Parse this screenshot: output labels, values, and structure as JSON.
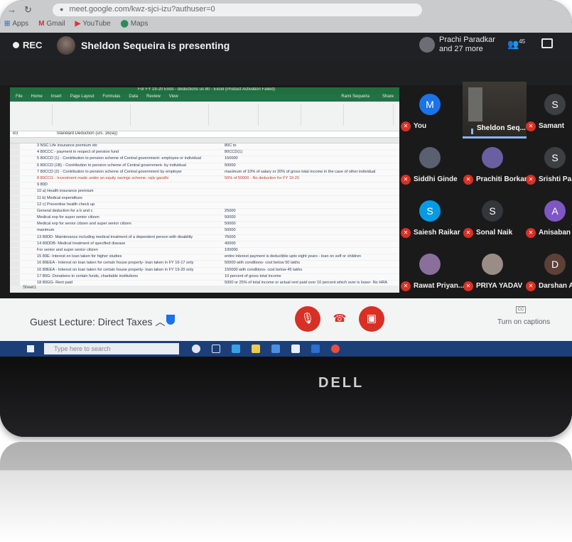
{
  "browser": {
    "url": "meet.google.com/kwz-sjci-izu?authuser=0",
    "bookmarks": [
      "Apps",
      "Gmail",
      "YouTube",
      "Maps"
    ]
  },
  "meet": {
    "rec_label": "REC",
    "presenting_text": "Sheldon Sequeira is presenting",
    "attendee_line1": "Prachi Paradkar",
    "attendee_line2": "and 27 more",
    "people_count": "45",
    "meeting_title": "Guest Lecture: Direct Taxes",
    "captions_label": "Turn on captions",
    "cc_label": "CC"
  },
  "excel": {
    "window_title": "For FY 19-20 Ends - deductions us 80 - Excel (Product Activation Failed)",
    "tabs": [
      "File",
      "Home",
      "Insert",
      "Page Layout",
      "Formulas",
      "Data",
      "Review",
      "View"
    ],
    "user": "Rami Sequeira",
    "share": "Share",
    "name_box": "B3",
    "formula": "Standard Deduction (u/s. 16(ia))",
    "sheet_tab": "Sheet1",
    "rows": [
      {
        "a": "3 NSC Life insurance premium etc",
        "c": "80C to"
      },
      {
        "a": "4 80CCC - payment in respect of pension fund",
        "c": "80CCD(1)"
      },
      {
        "a": "5 80CCD (1) - Contribution to pension scheme of Central government- employee or individual",
        "c": "150000"
      },
      {
        "a": "6 80CCD (1B) - Contribution to pension scheme of Central government- by individual",
        "c": "50000"
      },
      {
        "a": "7 80CCD (2) - Contribution to pension scheme of Central government by employer",
        "c": "maximum of 10% of salary or 20% of gross total income in the case of other individual"
      },
      {
        "a": "8 80CCG - Investment made under an equity savings scheme- rajiv gandhi",
        "c": "50% of 50000 - No deduction for FY 19-20",
        "red": true
      },
      {
        "a": "9 80D",
        "c": ""
      },
      {
        "a": "10 a) Health insurance premium",
        "c": ""
      },
      {
        "a": "11 b) Medical expenditure",
        "c": ""
      },
      {
        "a": "12 c) Preventive health check up",
        "c": ""
      },
      {
        "a": "General deduction for a b and c",
        "c": "25000"
      },
      {
        "a": "Medical exp for super senior citizen",
        "c": "50000"
      },
      {
        "a": "Medical exp for senior citizen and super senior citizen",
        "c": "50000"
      },
      {
        "a": "maximum",
        "c": "50000"
      },
      {
        "a": "13 80DD- Maintenance including medical treatment of a dependent person with disability",
        "c": "75000"
      },
      {
        "a": "14 80DDB- Medical treatment of specified disease",
        "c": "40000"
      },
      {
        "a": "For senior and super senior citizen",
        "c": "100000"
      },
      {
        "a": "15 80E- Interest on loan taken for higher studies",
        "c": "entire interest payment is deductible upto eight years - loan on self or children"
      },
      {
        "a": "16 80EEA - Interest on loan taken for certain house property- loan taken in FY 16-17 only",
        "c": "50000 with conditions- cost below 50 lakhs"
      },
      {
        "a": "16 80EEA - Interest on loan taken for certain house property- loan taken in FY 19-20 only",
        "c": "150000 with conditions- cost below 45 lakhs"
      },
      {
        "a": "17 80G- Donations to certain funds, charitable institutions",
        "c": "10 percent of gross total income"
      },
      {
        "a": "18 80GG- Rent paid",
        "c": "5000 or 25% of total income or actual rent paid over 10 percent which ever is lower- No HRA"
      }
    ]
  },
  "participants": [
    {
      "name": "You",
      "initial": "M",
      "color": "#1a73e8"
    },
    {
      "name": "Samant",
      "initial": "S",
      "color": "#3c4043"
    },
    {
      "name": "Siddhi Ginde",
      "initial": "",
      "color": "#5a6070"
    },
    {
      "name": "Prachiti Borkar",
      "initial": "",
      "color": "#6a5fa0"
    },
    {
      "name": "Srishti Pa",
      "initial": "S",
      "color": "#3c4043"
    },
    {
      "name": "Saiesh Raikar",
      "initial": "S",
      "color": "#039be5"
    },
    {
      "name": "Sonal Naik",
      "initial": "S",
      "color": "#33363a"
    },
    {
      "name": "Anisaban",
      "initial": "A",
      "color": "#7e57c2"
    },
    {
      "name": "Rawat Priyan...",
      "initial": "",
      "color": "#8a6f9a"
    },
    {
      "name": "PRIYA YADAV",
      "initial": "",
      "color": "#9a8d86"
    },
    {
      "name": "Darshan A",
      "initial": "D",
      "color": "#5d4037"
    }
  ],
  "video_participant": {
    "name": "Sheldon Seq..."
  },
  "taskbar": {
    "search_placeholder": "Type here to search"
  },
  "bezel": {
    "brand": "DELL"
  }
}
